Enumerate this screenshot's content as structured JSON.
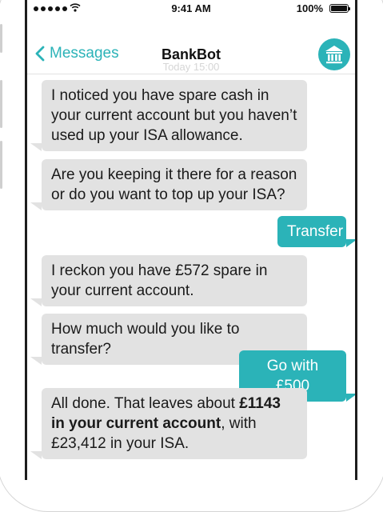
{
  "status_bar": {
    "time": "9:41 AM",
    "battery": "100%"
  },
  "nav": {
    "back_label": "Messages",
    "title": "BankBot",
    "subtitle": "Today 15:00"
  },
  "messages": [
    {
      "from": "bot",
      "text": "I noticed you have spare cash in your current account but you haven’t used up your ISA allowance."
    },
    {
      "from": "bot",
      "text": "Are you keeping it there for a reason or do you want to top up your ISA?"
    },
    {
      "from": "user",
      "text": "Transfer"
    },
    {
      "from": "bot",
      "text": "I reckon you have £572 spare in your current account."
    },
    {
      "from": "bot",
      "text": "How much would you like to transfer?"
    },
    {
      "from": "user",
      "text": "Go with £500"
    },
    {
      "from": "bot",
      "parts": [
        "All done. That leaves about ",
        "£1143 in your current account",
        ", with £23,412 in your ISA."
      ]
    }
  ],
  "colors": {
    "accent": "#2bb3b8",
    "bot_bubble": "#e2e2e2",
    "frame": "#1d1d1d"
  },
  "icons": {
    "back": "chevron-left-icon",
    "avatar": "bank-icon",
    "wifi": "wifi-icon",
    "battery": "battery-icon"
  }
}
